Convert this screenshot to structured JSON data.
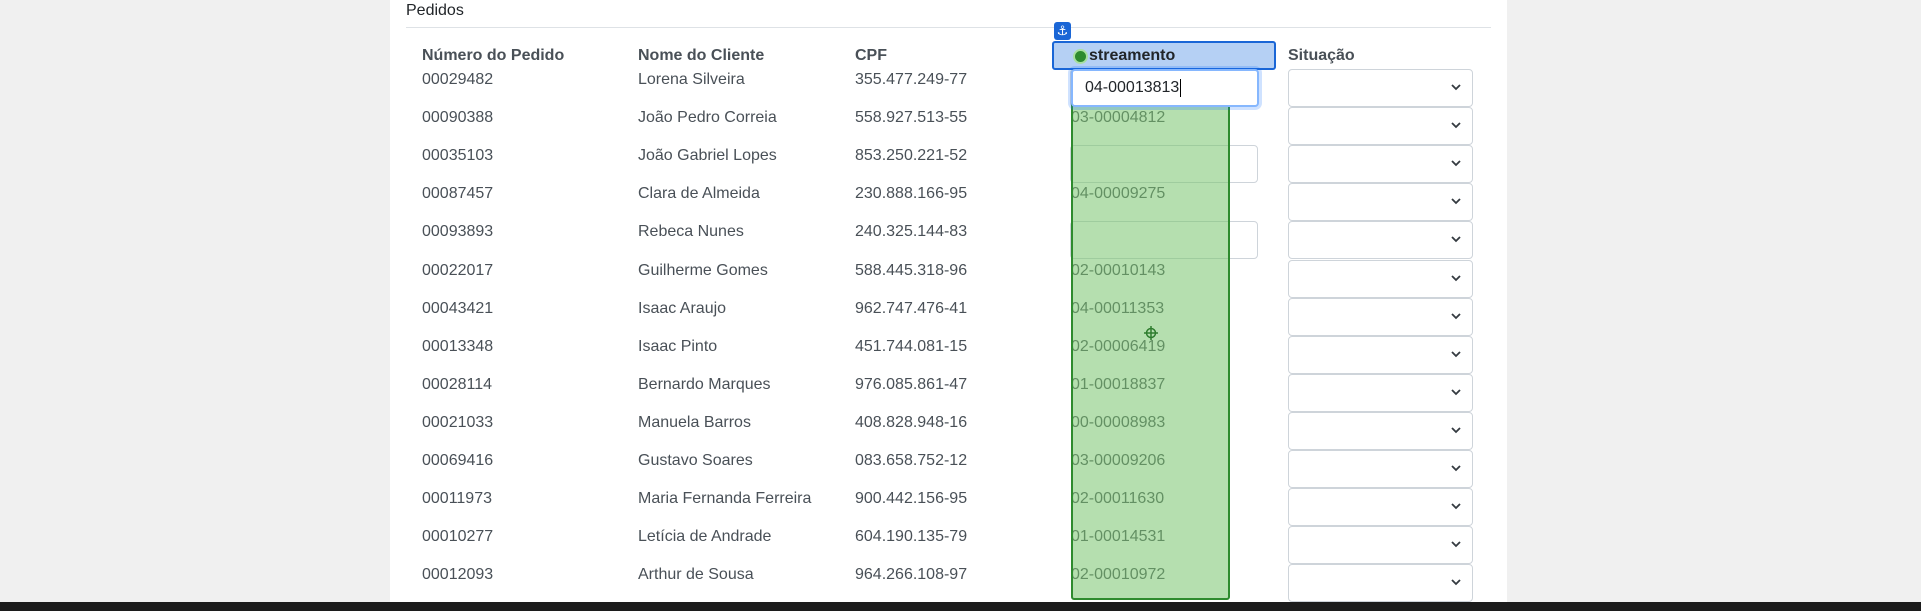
{
  "section": {
    "title": "Pedidos"
  },
  "table": {
    "headers": {
      "order": "Número do Pedido",
      "client": "Nome do Cliente",
      "cpf": "CPF",
      "tracking": "streamento",
      "status": "Situação"
    },
    "active_input_value": "04-00013813",
    "rows": [
      {
        "order": "00029482",
        "client": "Lorena Silveira",
        "cpf": "355.477.249-77",
        "tracking": ""
      },
      {
        "order": "00090388",
        "client": "João Pedro Correia",
        "cpf": "558.927.513-55",
        "tracking": "03-00004812"
      },
      {
        "order": "00035103",
        "client": "João Gabriel Lopes",
        "cpf": "853.250.221-52",
        "tracking": ""
      },
      {
        "order": "00087457",
        "client": "Clara de Almeida",
        "cpf": "230.888.166-95",
        "tracking": "04-00009275"
      },
      {
        "order": "00093893",
        "client": "Rebeca Nunes",
        "cpf": "240.325.144-83",
        "tracking": ""
      },
      {
        "order": "00022017",
        "client": "Guilherme Gomes",
        "cpf": "588.445.318-96",
        "tracking": "02-00010143"
      },
      {
        "order": "00043421",
        "client": "Isaac Araujo",
        "cpf": "962.747.476-41",
        "tracking": "04-00011353"
      },
      {
        "order": "00013348",
        "client": "Isaac Pinto",
        "cpf": "451.744.081-15",
        "tracking": "02-00006419"
      },
      {
        "order": "00028114",
        "client": "Bernardo Marques",
        "cpf": "976.085.861-47",
        "tracking": "01-00018837"
      },
      {
        "order": "00021033",
        "client": "Manuela Barros",
        "cpf": "408.828.948-16",
        "tracking": "00-00008983"
      },
      {
        "order": "00069416",
        "client": "Gustavo Soares",
        "cpf": "083.658.752-12",
        "tracking": "03-00009206"
      },
      {
        "order": "00011973",
        "client": "Maria Fernanda Ferreira",
        "cpf": "900.442.156-95",
        "tracking": "02-00011630"
      },
      {
        "order": "00010277",
        "client": "Letícia de Andrade",
        "cpf": "604.190.135-79",
        "tracking": "01-00014531"
      },
      {
        "order": "00012093",
        "client": "Arthur de Sousa",
        "cpf": "964.266.108-97",
        "tracking": "02-00010972"
      }
    ]
  },
  "icons": {
    "anchor": "anchor-icon",
    "target": "target-icon",
    "crosshair": "crosshair-icon",
    "select_chevron": "chevron-down-icon"
  },
  "colors": {
    "selection_green": "#2e8b2e",
    "header_selection_blue": "#1a66d6"
  }
}
